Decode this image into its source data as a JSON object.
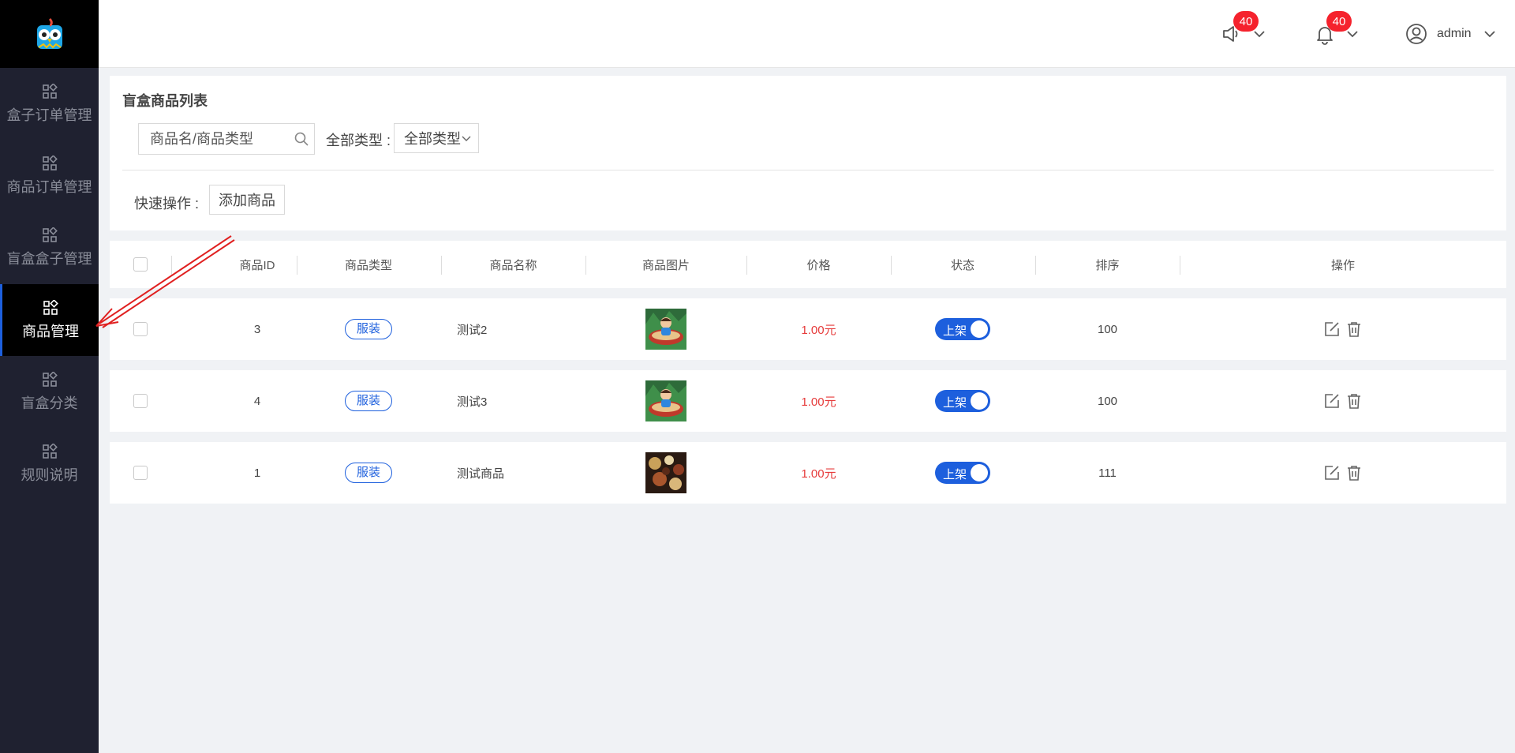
{
  "header": {
    "announcement_badge": "40",
    "notification_badge": "40",
    "user_name": "admin"
  },
  "sidebar": {
    "items": [
      {
        "label": "盒子订单管理"
      },
      {
        "label": "商品订单管理"
      },
      {
        "label": "盲盒盒子管理"
      },
      {
        "label": "商品管理",
        "active": true
      },
      {
        "label": "盲盒分类"
      },
      {
        "label": "规则说明"
      }
    ]
  },
  "filter": {
    "title": "盲盒商品列表",
    "search_placeholder": "商品名/商品类型",
    "type_label": "全部类型 :",
    "type_selected": "全部类型",
    "quick_label": "快速操作 :",
    "add_button": "添加商品"
  },
  "table": {
    "headers": {
      "id": "商品ID",
      "type": "商品类型",
      "name": "商品名称",
      "image": "商品图片",
      "price": "价格",
      "status": "状态",
      "sort": "排序",
      "ops": "操作"
    },
    "rows": [
      {
        "id": "3",
        "type": "服装",
        "name": "测试2",
        "price": "1.00元",
        "status": "上架",
        "sort": "100",
        "image_icon": "cartoon-boy-thumbnail"
      },
      {
        "id": "4",
        "type": "服装",
        "name": "测试3",
        "price": "1.00元",
        "status": "上架",
        "sort": "100",
        "image_icon": "cartoon-boy-thumbnail"
      },
      {
        "id": "1",
        "type": "服装",
        "name": "测试商品",
        "price": "1.00元",
        "status": "上架",
        "sort": "111",
        "image_icon": "food-photo-thumbnail"
      }
    ]
  },
  "colors": {
    "sidebar_bg": "#1f2130",
    "accent": "#1d5fdd",
    "price": "#e63b3b",
    "badge": "#f5222d"
  }
}
